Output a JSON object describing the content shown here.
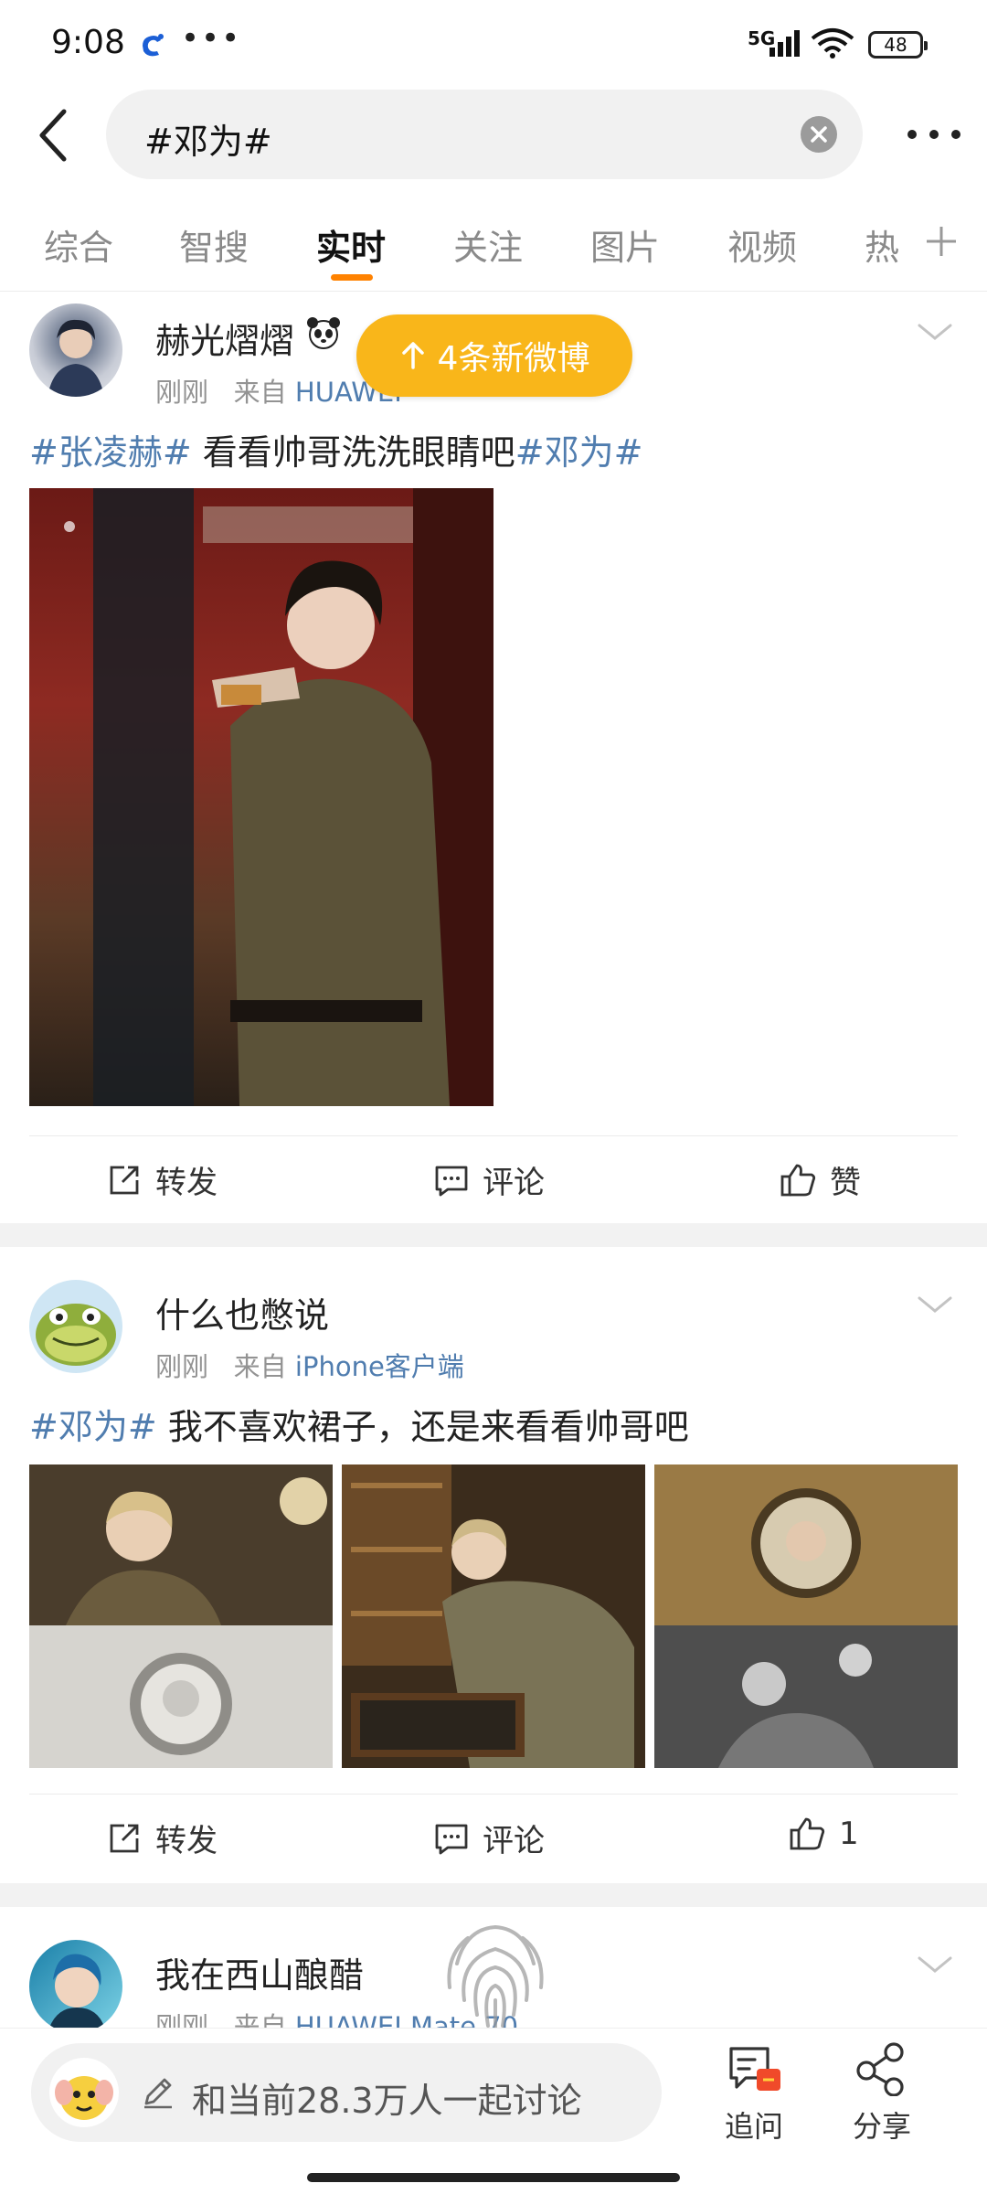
{
  "status_bar": {
    "time": "9:08",
    "network": "5G",
    "battery": "48",
    "more_glyph": "•••"
  },
  "search": {
    "query": "#邓为#"
  },
  "tabs": [
    {
      "label": "综合"
    },
    {
      "label": "智搜"
    },
    {
      "label": "实时"
    },
    {
      "label": "关注"
    },
    {
      "label": "图片"
    },
    {
      "label": "视频"
    },
    {
      "label": "热"
    }
  ],
  "active_tab": "实时",
  "new_posts_pill": "4条新微博",
  "posts": [
    {
      "username": "赫光熠熠",
      "time": "刚刚",
      "from_label": "来自",
      "source": "HUAWEI",
      "text_parts": [
        "#张凌赫#",
        " 看看帅哥洗洗眼睛吧",
        "#邓为#"
      ],
      "repost_label": "转发",
      "comment_label": "评论",
      "like_label": "赞"
    },
    {
      "username": "什么也憋说",
      "time": "刚刚",
      "from_label": "来自",
      "source": "iPhone客户端",
      "text_parts": [
        "#邓为#",
        " 我不喜欢裙子，还是来看看帅哥吧"
      ],
      "repost_label": "转发",
      "comment_label": "评论",
      "like_label": "1"
    },
    {
      "username": "我在西山酿醋",
      "time": "刚刚",
      "from_label": "来自",
      "source": "HUAWEI Mate 70"
    }
  ],
  "bottom_bar": {
    "discuss_text": "和当前28.3万人一起讨论",
    "ask_label": "追问",
    "share_label": "分享"
  },
  "colors": {
    "accent": "#ff8200",
    "pill": "#f9b61a",
    "link": "#507daf"
  },
  "icons": [
    "back-icon",
    "clear-icon",
    "more-icon",
    "add-tab-icon",
    "repost-icon",
    "comment-icon",
    "like-icon",
    "chevron-down-icon",
    "pencil-icon",
    "ask-icon",
    "share-icon",
    "fingerprint-icon",
    "arrow-up-icon"
  ]
}
